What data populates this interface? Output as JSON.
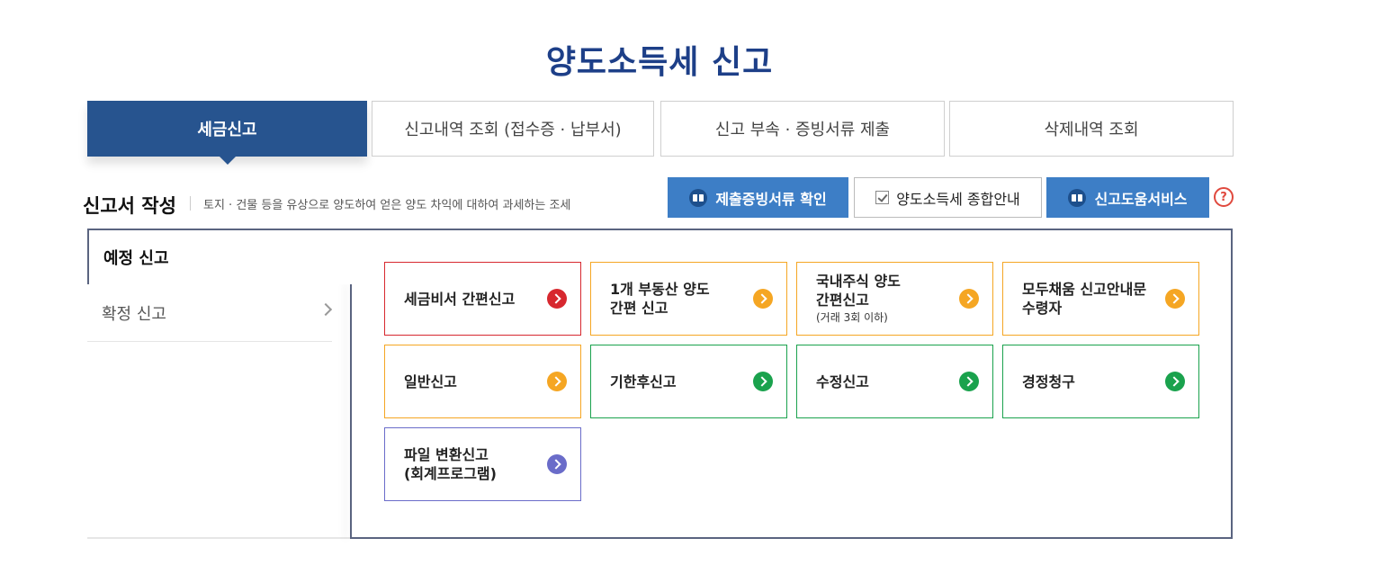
{
  "page_title": "양도소득세 신고",
  "tabs": [
    {
      "label": "세금신고"
    },
    {
      "label": "신고내역 조회 (접수증 · 납부서)"
    },
    {
      "label": "신고 부속 · 증빙서류 제출"
    },
    {
      "label": "삭제내역 조회"
    }
  ],
  "section": {
    "title": "신고서 작성",
    "description": "토지 · 건물 등을 유상으로 양도하여 얻은 양도 차익에 대하여 과세하는 조세"
  },
  "header_buttons": {
    "evidence": "제출증빙서류 확인",
    "guide": "양도소득세 종합안내",
    "help_service": "신고도움서비스",
    "help_icon": "?"
  },
  "side_menu": [
    {
      "label": "예정 신고"
    },
    {
      "label": "확정 신고"
    }
  ],
  "cards": [
    {
      "lines": [
        "세금비서 간편신고"
      ],
      "color": "#d7282f"
    },
    {
      "lines": [
        "1개 부동산 양도",
        "간편 신고"
      ],
      "color": "#f5a623"
    },
    {
      "lines": [
        "국내주식 양도",
        "간편신고"
      ],
      "sub": "(거래 3회 이하)",
      "color": "#f5a623"
    },
    {
      "lines": [
        "모두채움 신고안내문",
        "수령자"
      ],
      "color": "#f5a623"
    },
    {
      "lines": [
        "일반신고"
      ],
      "color": "#f5a623"
    },
    {
      "lines": [
        "기한후신고"
      ],
      "color": "#1aa24d"
    },
    {
      "lines": [
        "수정신고"
      ],
      "color": "#1aa24d"
    },
    {
      "lines": [
        "경정청구"
      ],
      "color": "#1aa24d"
    },
    {
      "lines": [
        "파일 변환신고",
        "(회계프로그램)"
      ],
      "color": "#6a6cc9"
    }
  ]
}
